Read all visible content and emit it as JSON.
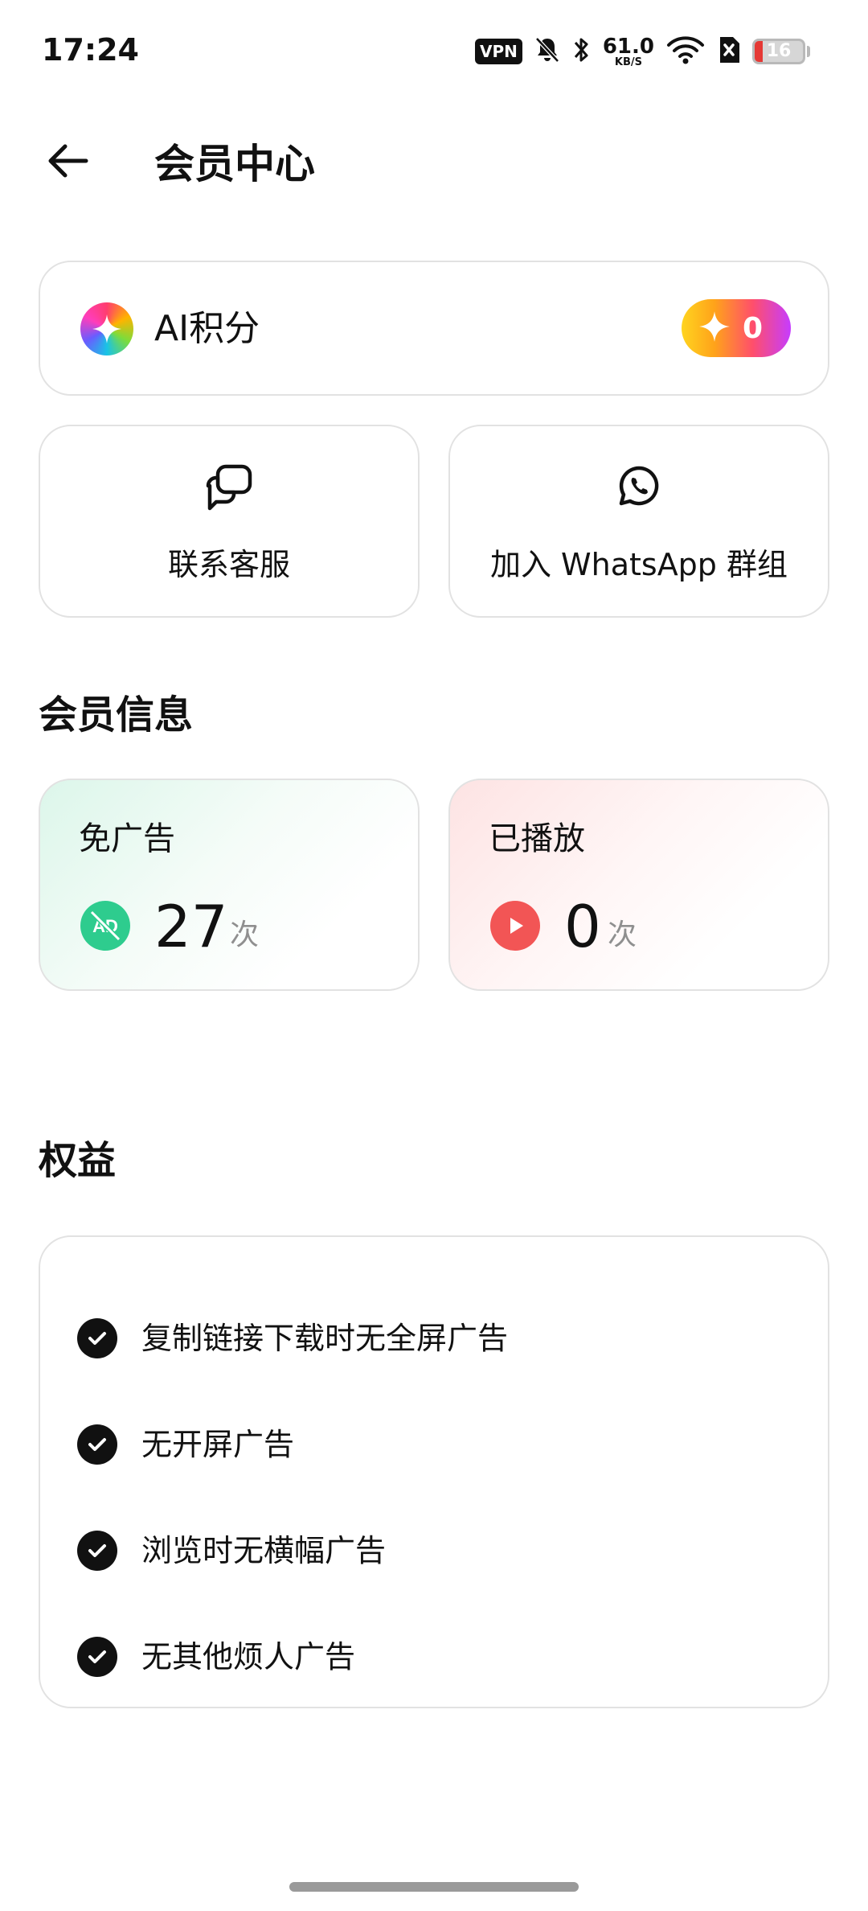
{
  "status_bar": {
    "time": "17:24",
    "vpn": "VPN",
    "speed_value": "61.0",
    "speed_unit": "KB/S",
    "battery": "16",
    "battery_level_percent": 16,
    "battery_color": "#e53935"
  },
  "header": {
    "title": "会员中心",
    "back_icon": "arrow-left-icon"
  },
  "ai_points": {
    "label": "AI积分",
    "value": "0",
    "icon": "sparkle-icon"
  },
  "actions": {
    "contact": {
      "label": "联系客服",
      "icon": "chat-bubbles-icon"
    },
    "whatsapp": {
      "label": "加入 WhatsApp 群组",
      "icon": "whatsapp-icon"
    }
  },
  "member_info": {
    "title": "会员信息",
    "ad_free": {
      "label": "免广告",
      "value": "27",
      "unit": "次",
      "icon": "no-ad-icon",
      "color": "#2ecc8e"
    },
    "played": {
      "label": "已播放",
      "value": "0",
      "unit": "次",
      "icon": "play-icon",
      "color": "#f25555"
    }
  },
  "benefits": {
    "title": "权益",
    "items": [
      {
        "text": "复制链接下载时无全屏广告"
      },
      {
        "text": "无开屏广告"
      },
      {
        "text": "浏览时无横幅广告"
      },
      {
        "text": "无其他烦人广告"
      }
    ]
  }
}
